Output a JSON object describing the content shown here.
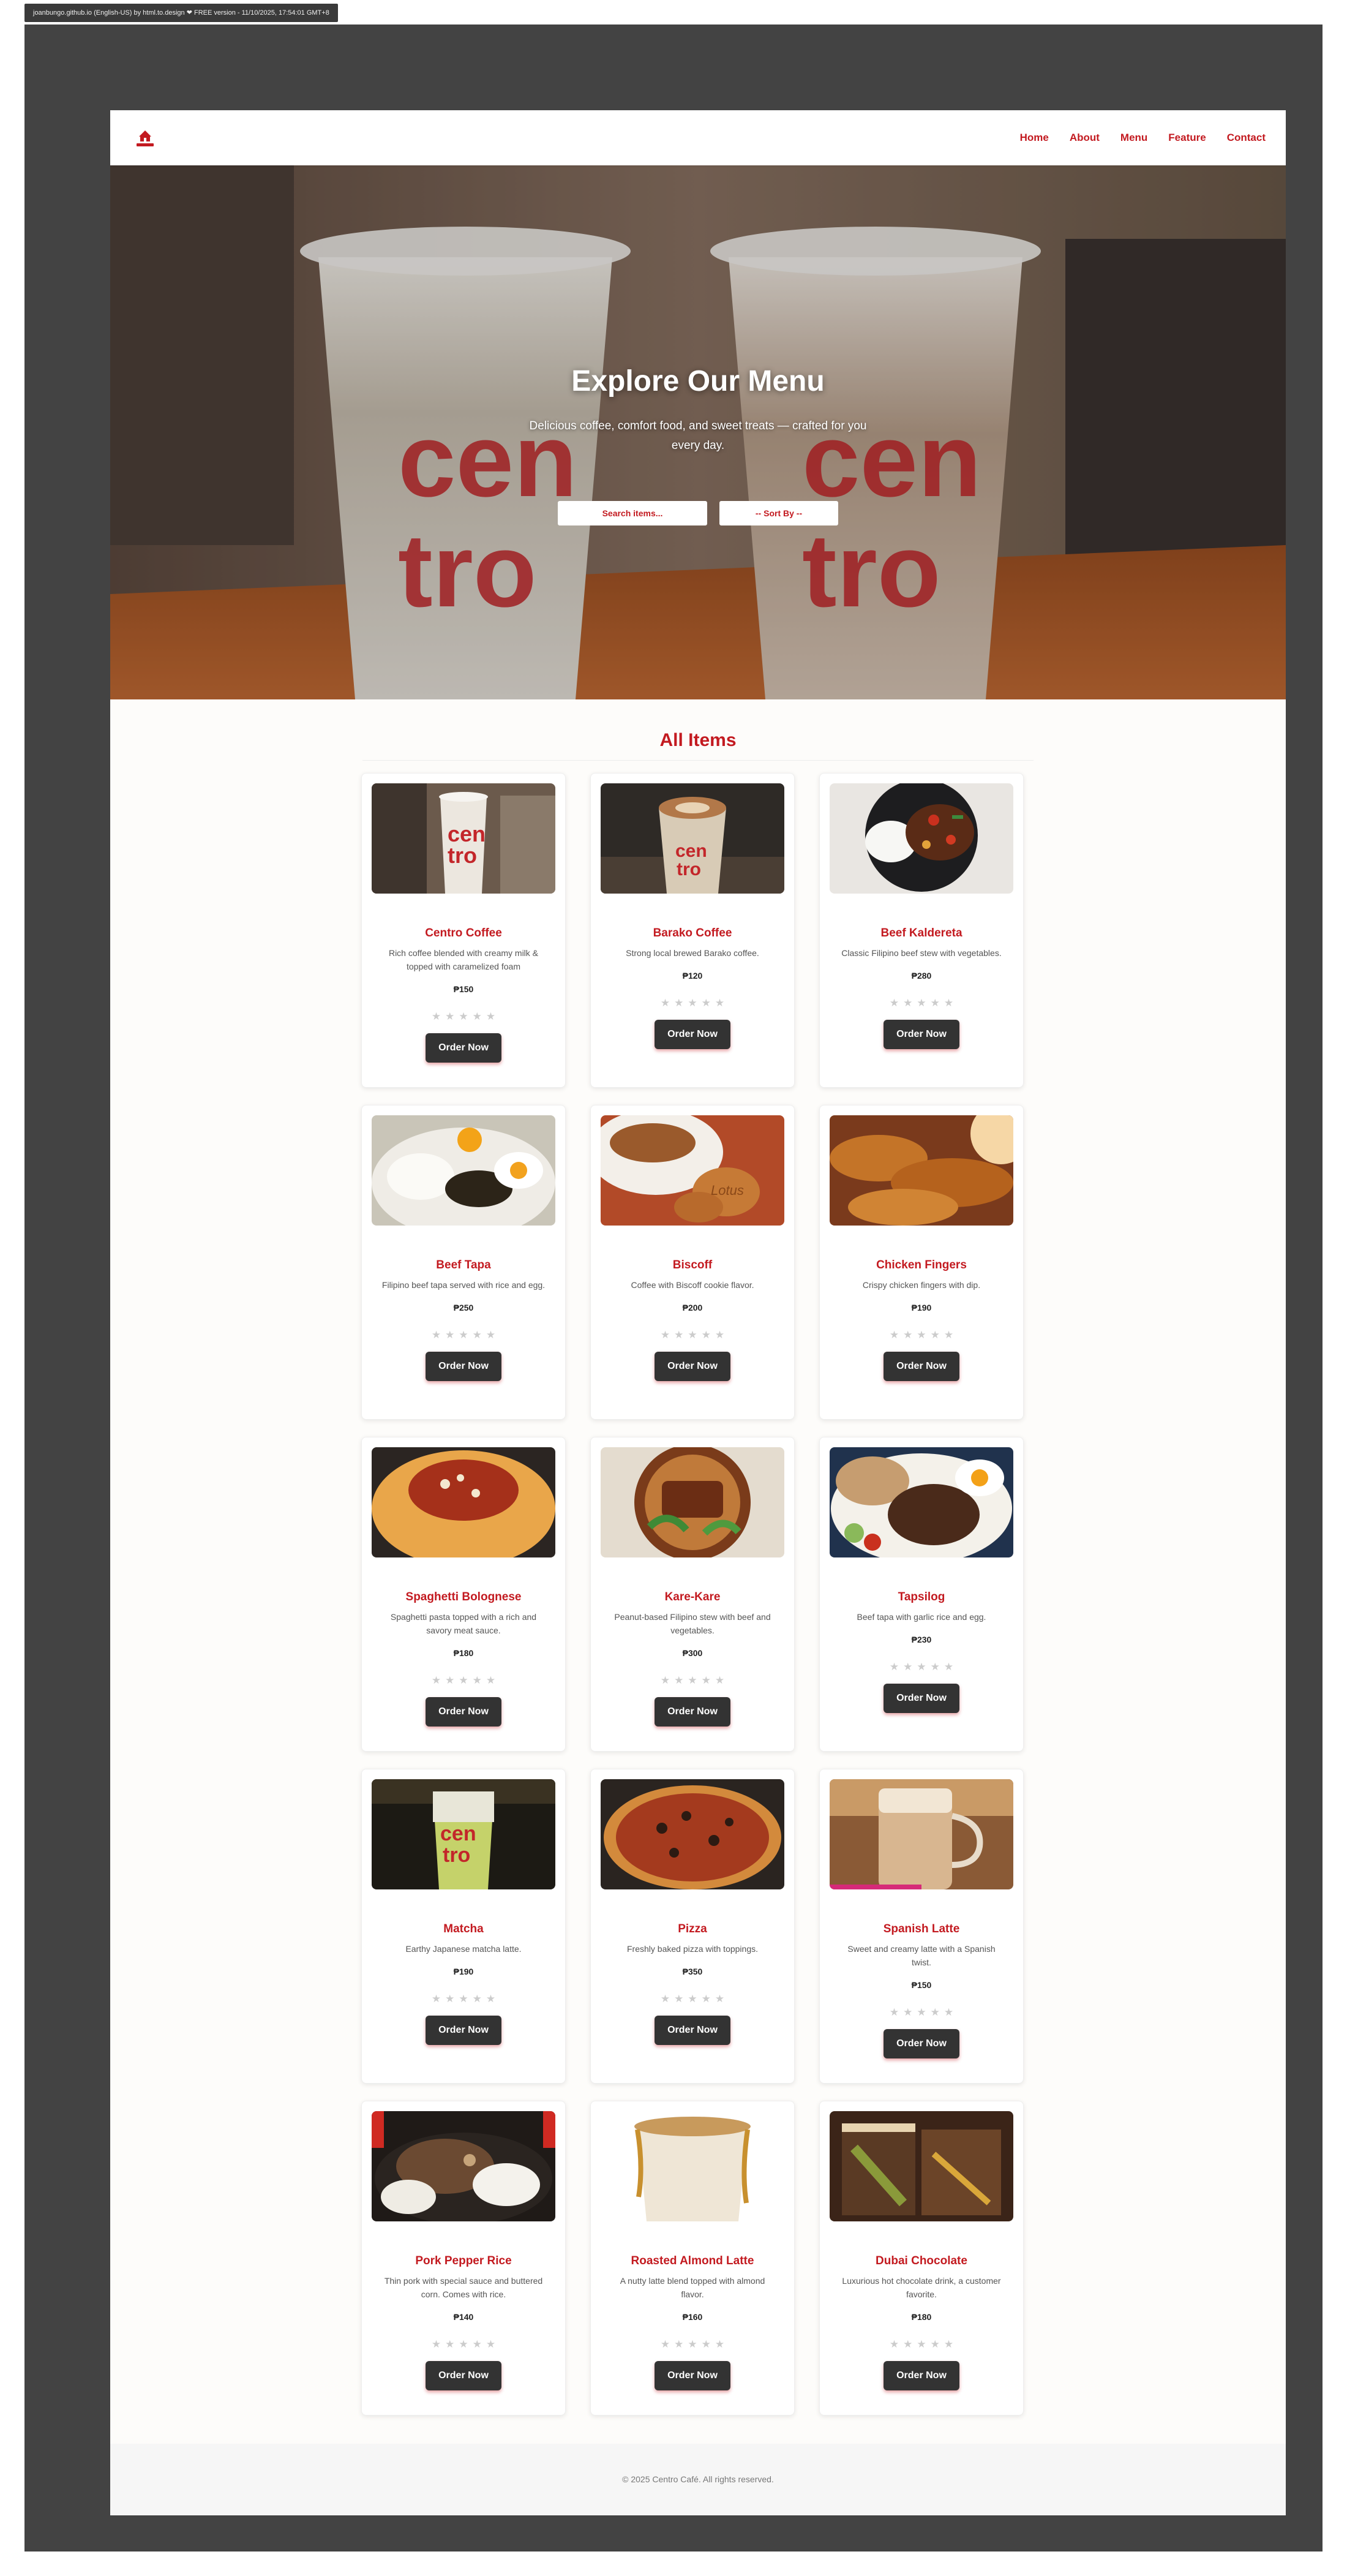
{
  "browser": {
    "capture_tag": "joanbungo.github.io (English-US) by html.to.design ❤ FREE version - 11/10/2025, 17:54:01 GMT+8"
  },
  "navbar": {
    "logo_icon": "centro-cafe-logo",
    "links": [
      "Home",
      "About",
      "Menu",
      "Feature",
      "Contact"
    ]
  },
  "hero": {
    "title": "Explore Our Menu",
    "subtitle": "Delicious coffee, comfort food, and sweet treats — crafted for you every day.",
    "search_placeholder": "Search items...",
    "sort_label": "-- Sort By --"
  },
  "section": {
    "title": "All Items"
  },
  "menu_items": [
    {
      "name": "Centro Coffee",
      "description": "Rich coffee blended with creamy milk & topped with caramelized foam",
      "price": "₱150",
      "rating": 0,
      "button": "Order Now"
    },
    {
      "name": "Barako Coffee",
      "description": "Strong local brewed Barako coffee.",
      "price": "₱120",
      "rating": 0,
      "button": "Order Now"
    },
    {
      "name": "Beef Kaldereta",
      "description": "Classic Filipino beef stew with vegetables.",
      "price": "₱280",
      "rating": 0,
      "button": "Order Now"
    },
    {
      "name": "Beef Tapa",
      "description": "Filipino beef tapa served with rice and egg.",
      "price": "₱250",
      "rating": 0,
      "button": "Order Now"
    },
    {
      "name": "Biscoff",
      "description": "Coffee with Biscoff cookie flavor.",
      "price": "₱200",
      "rating": 0,
      "button": "Order Now"
    },
    {
      "name": "Chicken Fingers",
      "description": "Crispy chicken fingers with dip.",
      "price": "₱190",
      "rating": 0,
      "button": "Order Now"
    },
    {
      "name": "Spaghetti Bolognese",
      "description": "Spaghetti pasta topped with a rich and savory meat sauce.",
      "price": "₱180",
      "rating": 0,
      "button": "Order Now"
    },
    {
      "name": "Kare-Kare",
      "description": "Peanut-based Filipino stew with beef and vegetables.",
      "price": "₱300",
      "rating": 0,
      "button": "Order Now"
    },
    {
      "name": "Tapsilog",
      "description": "Beef tapa with garlic rice and egg.",
      "price": "₱230",
      "rating": 0,
      "button": "Order Now"
    },
    {
      "name": "Matcha",
      "description": "Earthy Japanese matcha latte.",
      "price": "₱190",
      "rating": 0,
      "button": "Order Now"
    },
    {
      "name": "Pizza",
      "description": "Freshly baked pizza with toppings.",
      "price": "₱350",
      "rating": 0,
      "button": "Order Now"
    },
    {
      "name": "Spanish Latte",
      "description": "Sweet and creamy latte with a Spanish twist.",
      "price": "₱150",
      "rating": 0,
      "button": "Order Now"
    },
    {
      "name": "Pork Pepper Rice",
      "description": "Thin pork with special sauce and buttered corn. Comes with rice.",
      "price": "₱140",
      "rating": 0,
      "button": "Order Now"
    },
    {
      "name": "Roasted Almond Latte",
      "description": "A nutty latte blend topped with almond flavor.",
      "price": "₱160",
      "rating": 0,
      "button": "Order Now"
    },
    {
      "name": "Dubai Chocolate",
      "description": "Luxurious hot chocolate drink, a customer favorite.",
      "price": "₱180",
      "rating": 0,
      "button": "Order Now"
    }
  ],
  "footer": {
    "text": "© 2025 Centro Café. All rights reserved."
  },
  "colors": {
    "accent": "#c31a20",
    "button": "#333333",
    "frame": "#434343",
    "page_bg": "#fdfcfa",
    "star_empty": "#cccccc"
  }
}
